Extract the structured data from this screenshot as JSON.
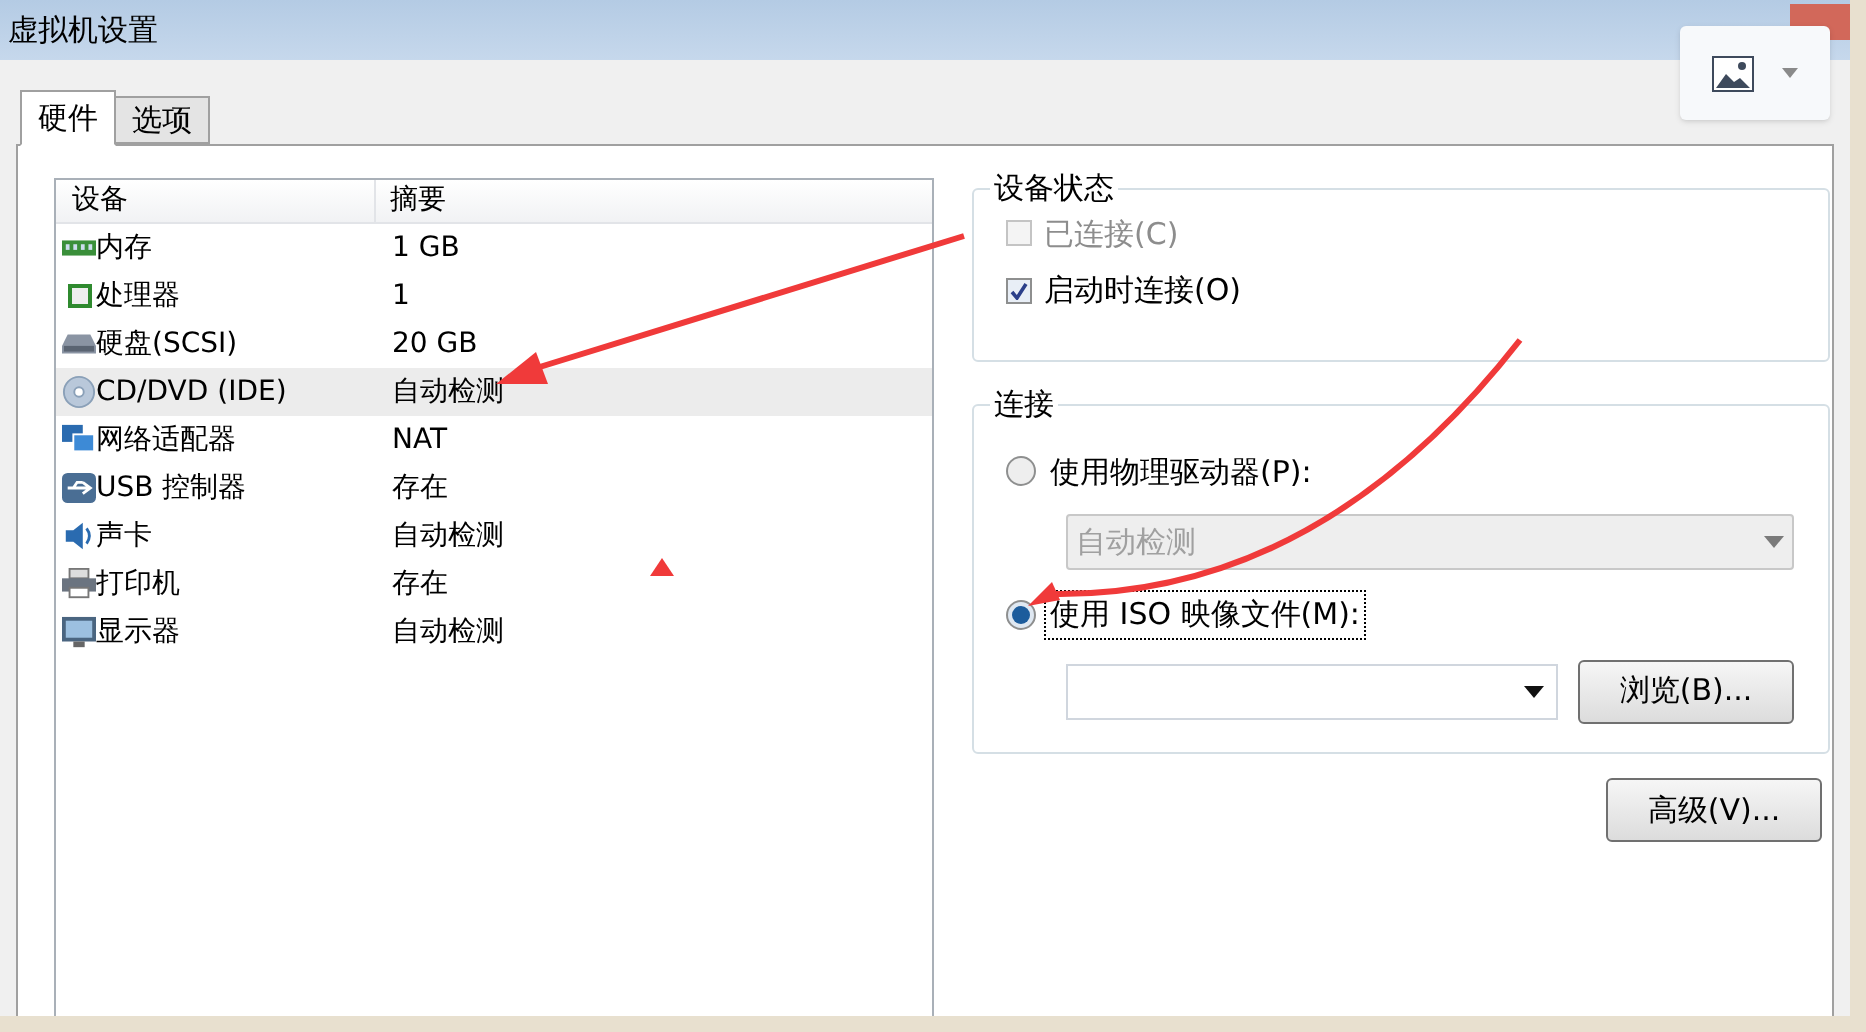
{
  "window": {
    "title": "虚拟机设置"
  },
  "tabs": [
    {
      "label": "硬件",
      "selected": true
    },
    {
      "label": "选项",
      "selected": false
    }
  ],
  "devices": {
    "columns": [
      "设备",
      "摘要"
    ],
    "rows": [
      {
        "name": "内存",
        "summary": "1 GB",
        "selected": false
      },
      {
        "name": "处理器",
        "summary": "1",
        "selected": false
      },
      {
        "name": "硬盘(SCSI)",
        "summary": "20 GB",
        "selected": false
      },
      {
        "name": "CD/DVD (IDE)",
        "summary": "自动检测",
        "selected": true
      },
      {
        "name": "网络适配器",
        "summary": "NAT",
        "selected": false
      },
      {
        "name": "USB 控制器",
        "summary": "存在",
        "selected": false
      },
      {
        "name": "声卡",
        "summary": "自动检测",
        "selected": false
      },
      {
        "name": "打印机",
        "summary": "存在",
        "selected": false
      },
      {
        "name": "显示器",
        "summary": "自动检测",
        "selected": false
      }
    ]
  },
  "device_status": {
    "title": "设备状态",
    "checkboxes": [
      {
        "label": "已连接(C)",
        "checked": false,
        "disabled": true
      },
      {
        "label": "启动时连接(O)",
        "checked": true,
        "disabled": false
      }
    ]
  },
  "connection": {
    "title": "连接",
    "options": [
      {
        "label": "使用物理驱动器(P):",
        "selected": false
      },
      {
        "label": "使用 ISO 映像文件(M):",
        "selected": true
      }
    ],
    "physical_drive": {
      "value": "自动检测",
      "disabled": true
    },
    "browse_button": "浏览(B)..."
  },
  "advanced_button": "高级(V)..."
}
